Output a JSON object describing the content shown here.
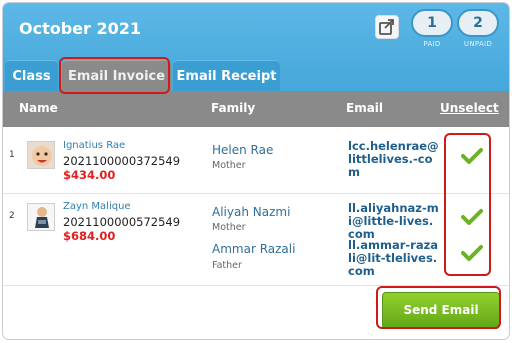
{
  "header": {
    "title": "October 2021",
    "paid": {
      "count": "1",
      "label": "PAID"
    },
    "unpaid": {
      "count": "2",
      "label": "UNPAID"
    }
  },
  "tabs": [
    {
      "label": "Class"
    },
    {
      "label": "Email Invoice",
      "active": true
    },
    {
      "label": "Email Receipt"
    }
  ],
  "columns": {
    "name": "Name",
    "family": "Family",
    "email": "Email",
    "unselect": "Unselect"
  },
  "rows": [
    {
      "index": "1",
      "name": "Ignatius Rae",
      "id": "2021100000372549",
      "amount": "$434.00",
      "family": [
        {
          "name": "Helen Rae",
          "relation": "Mother",
          "email": "lcc.helenrae@littlelives.-com",
          "selected": true
        }
      ]
    },
    {
      "index": "2",
      "name": "Zayn Malique",
      "id": "2021100000572549",
      "amount": "$684.00",
      "family": [
        {
          "name": "Aliyah Nazmi",
          "relation": "Mother",
          "email": "ll.aliyahnaz-mi@little-lives.com",
          "selected": true
        },
        {
          "name": "Ammar Razali",
          "relation": "Father",
          "email": "ll.ammar-razali@lit-tlelives.com",
          "selected": true
        }
      ]
    }
  ],
  "send_button": "Send Email",
  "colors": {
    "header_blue": "#4aaadb",
    "tab_blue": "#3b9ed3",
    "header_gray": "#8a8a8a",
    "amount_red": "#e02020",
    "check_green": "#6cb324",
    "highlight_red": "#d01a1a"
  }
}
